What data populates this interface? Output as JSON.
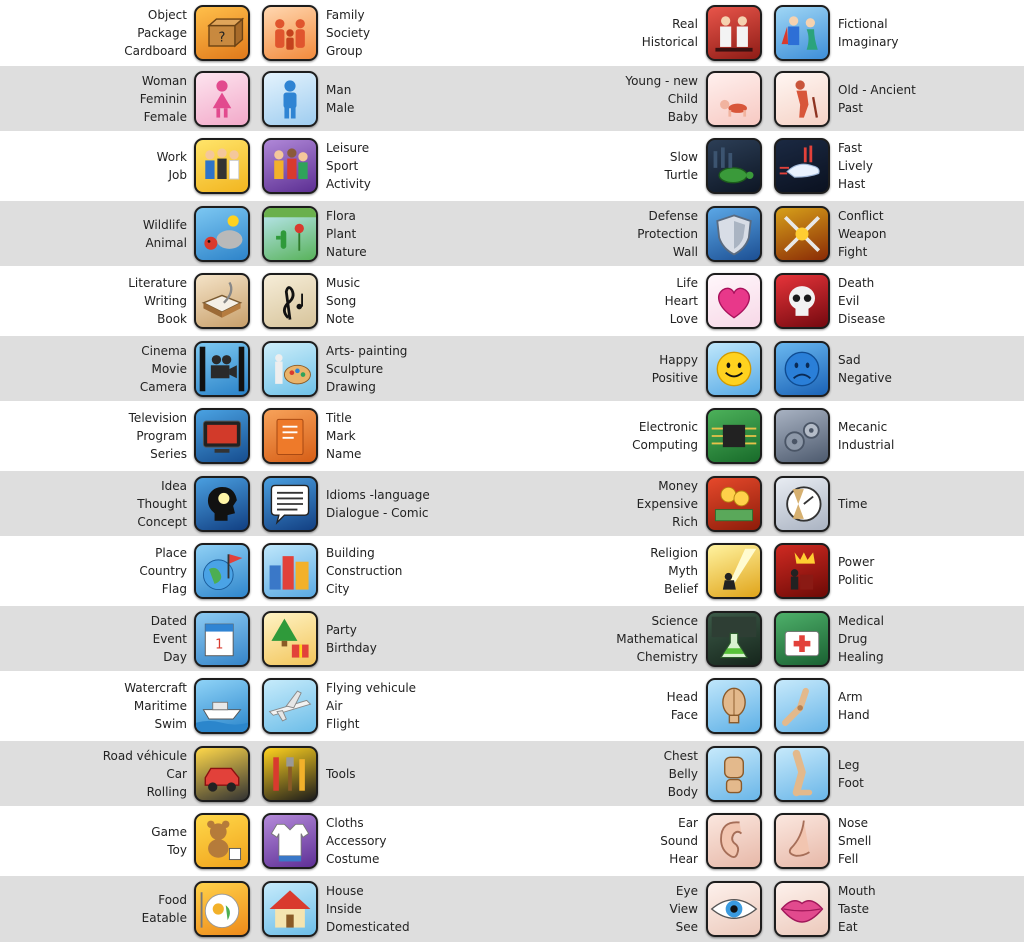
{
  "rows": [
    {
      "h": 66,
      "shaded": false,
      "cells": [
        {
          "words": [
            "Object",
            "Package",
            "Cardboard"
          ],
          "icon": "cardboard-box-icon",
          "bg": [
            "#ffbf4a",
            "#e0791b"
          ]
        },
        {
          "words": [
            "Family",
            "Society",
            "Group"
          ],
          "icon": "family-group-icon",
          "bg": [
            "#ffd7b0",
            "#f28a3c"
          ]
        },
        {
          "words": [
            "Real",
            "Historical"
          ],
          "icon": "historical-figures-icon",
          "bg": [
            "#e8554a",
            "#8e1c16"
          ]
        },
        {
          "words": [
            "Fictional",
            "Imaginary"
          ],
          "icon": "fictional-characters-icon",
          "bg": [
            "#9fd6f5",
            "#3d8ed8"
          ]
        }
      ]
    },
    {
      "h": 65,
      "shaded": true,
      "cells": [
        {
          "words": [
            "Woman",
            "Feminin",
            "Female"
          ],
          "icon": "woman-symbol-icon",
          "bg": [
            "#fde4ef",
            "#f2a9c9"
          ]
        },
        {
          "words": [
            "Man",
            "Male"
          ],
          "icon": "man-symbol-icon",
          "bg": [
            "#e4f3fd",
            "#9fcdf0"
          ]
        },
        {
          "words": [
            "Young - new",
            "Child",
            "Baby"
          ],
          "icon": "crawling-baby-icon",
          "bg": [
            "#fff0ee",
            "#f7c9c2"
          ]
        },
        {
          "words": [
            "Old - Ancient",
            "Past"
          ],
          "icon": "old-man-cane-icon",
          "bg": [
            "#fff6f2",
            "#f5d2c6"
          ]
        }
      ]
    },
    {
      "h": 70,
      "shaded": false,
      "cells": [
        {
          "words": [
            "Work",
            "Job"
          ],
          "icon": "workers-icon",
          "bg": [
            "#ffe46a",
            "#f2b51f"
          ]
        },
        {
          "words": [
            "Leisure",
            "Sport",
            "Activity"
          ],
          "icon": "leisure-people-icon",
          "bg": [
            "#b088d8",
            "#5c2f93"
          ]
        },
        {
          "words": [
            "Slow",
            "Turtle"
          ],
          "icon": "turtle-icon",
          "bg": [
            "#2c3e56",
            "#0d1624"
          ]
        },
        {
          "words": [
            "Fast",
            "Lively",
            "Hast"
          ],
          "icon": "fast-rabbit-icon",
          "bg": [
            "#1b2942",
            "#0a1120"
          ]
        }
      ]
    },
    {
      "h": 65,
      "shaded": true,
      "cells": [
        {
          "words": [
            "Wildlife",
            "Animal"
          ],
          "icon": "animals-icon",
          "bg": [
            "#7cc7f2",
            "#2d83c9"
          ]
        },
        {
          "words": [
            "Flora",
            "Plant",
            "Nature"
          ],
          "icon": "plants-icon",
          "bg": [
            "#bfe9f7",
            "#58b25a"
          ]
        },
        {
          "words": [
            "Defense",
            "Protection",
            "Wall"
          ],
          "icon": "shield-wall-icon",
          "bg": [
            "#5ba7e6",
            "#1c4f93"
          ]
        },
        {
          "words": [
            "Conflict",
            "Weapon",
            "Fight"
          ],
          "icon": "crossed-swords-icon",
          "bg": [
            "#d7a01a",
            "#8a2b06"
          ]
        }
      ]
    },
    {
      "h": 70,
      "shaded": false,
      "cells": [
        {
          "words": [
            "Literature",
            "Writing",
            "Book"
          ],
          "icon": "book-quill-icon",
          "bg": [
            "#f4e3c7",
            "#c89f6a"
          ]
        },
        {
          "words": [
            "Music",
            "Song",
            "Note"
          ],
          "icon": "treble-clef-icon",
          "bg": [
            "#f6edd8",
            "#d7c49b"
          ]
        },
        {
          "words": [
            "Life",
            "Heart",
            "Love"
          ],
          "icon": "heart-icon",
          "bg": [
            "#fff7fb",
            "#f7d8e7"
          ]
        },
        {
          "words": [
            "Death",
            "Evil",
            "Disease"
          ],
          "icon": "skull-icon",
          "bg": [
            "#e6343a",
            "#74090f"
          ]
        }
      ]
    },
    {
      "h": 65,
      "shaded": true,
      "cells": [
        {
          "words": [
            "Cinema",
            "Movie",
            "Camera"
          ],
          "icon": "movie-camera-icon",
          "bg": [
            "#7ec9f2",
            "#2a82c8"
          ]
        },
        {
          "words": [
            "Arts- painting",
            "Sculpture",
            "Drawing"
          ],
          "icon": "palette-statue-icon",
          "bg": [
            "#cdeefa",
            "#6ec1e8"
          ]
        },
        {
          "words": [
            "Happy",
            "Positive"
          ],
          "icon": "smiley-face-icon",
          "bg": [
            "#bfe7fb",
            "#56a9e5"
          ]
        },
        {
          "words": [
            "Sad",
            "Negative"
          ],
          "icon": "sad-face-icon",
          "bg": [
            "#6ab8f0",
            "#1a62b6"
          ]
        }
      ]
    },
    {
      "h": 70,
      "shaded": false,
      "cells": [
        {
          "words": [
            "Television",
            "Program",
            "Series"
          ],
          "icon": "television-icon",
          "bg": [
            "#4aa2e2",
            "#164d8f"
          ]
        },
        {
          "words": [
            "Title",
            "Mark",
            "Name"
          ],
          "icon": "title-card-icon",
          "bg": [
            "#f7a25a",
            "#d65e16"
          ]
        },
        {
          "words": [
            "Electronic",
            "Computing"
          ],
          "icon": "circuit-board-icon",
          "bg": [
            "#4cb15a",
            "#186b2a"
          ]
        },
        {
          "words": [
            "Mecanic",
            "Industrial"
          ],
          "icon": "gears-machine-icon",
          "bg": [
            "#a8b2c2",
            "#4d5a6e"
          ]
        }
      ]
    },
    {
      "h": 65,
      "shaded": true,
      "cells": [
        {
          "words": [
            "Idea",
            "Thought",
            "Concept"
          ],
          "icon": "head-lightbulb-icon",
          "bg": [
            "#4a9fe0",
            "#113f82"
          ]
        },
        {
          "words": [
            "Idioms -language",
            "Dialogue - Comic"
          ],
          "icon": "speech-bubble-icon",
          "bg": [
            "#4a9fe0",
            "#123f82"
          ]
        },
        {
          "words": [
            "Money",
            "Expensive",
            "Rich"
          ],
          "icon": "money-coins-icon",
          "bg": [
            "#e6492b",
            "#8d1c0a"
          ]
        },
        {
          "words": [
            "Time"
          ],
          "icon": "hourglass-clock-icon",
          "bg": [
            "#e8ecf2",
            "#aab3c2"
          ]
        }
      ]
    },
    {
      "h": 70,
      "shaded": false,
      "cells": [
        {
          "words": [
            "Place",
            "Country",
            "Flag"
          ],
          "icon": "globe-flag-icon",
          "bg": [
            "#8fd0f5",
            "#2f86cc"
          ]
        },
        {
          "words": [
            "Building",
            "Construction",
            "City"
          ],
          "icon": "city-buildings-icon",
          "bg": [
            "#bfe7fb",
            "#5aa9e2"
          ]
        },
        {
          "words": [
            "Religion",
            "Myth",
            "Belief"
          ],
          "icon": "praying-light-icon",
          "bg": [
            "#fff3a0",
            "#e0a41a"
          ]
        },
        {
          "words": [
            "Power",
            "Politic"
          ],
          "icon": "crown-speaker-icon",
          "bg": [
            "#cf2a22",
            "#6d0a06"
          ]
        }
      ]
    },
    {
      "h": 65,
      "shaded": true,
      "cells": [
        {
          "words": [
            "Dated",
            "Event",
            "Day"
          ],
          "icon": "calendar-icon",
          "bg": [
            "#8ccaf2",
            "#3584c8"
          ]
        },
        {
          "words": [
            "Party",
            "Birthday"
          ],
          "icon": "christmas-tree-gift-icon",
          "bg": [
            "#fff3c4",
            "#f2c55b"
          ]
        },
        {
          "words": [
            "Science",
            "Mathematical",
            "Chemistry"
          ],
          "icon": "flask-chalkboard-icon",
          "bg": [
            "#3c5a48",
            "#16261c"
          ]
        },
        {
          "words": [
            "Medical",
            "Drug",
            "Healing"
          ],
          "icon": "first-aid-kit-icon",
          "bg": [
            "#4eb06a",
            "#1a6132"
          ]
        }
      ]
    },
    {
      "h": 70,
      "shaded": false,
      "cells": [
        {
          "words": [
            "Watercraft",
            "Maritime",
            "Swim"
          ],
          "icon": "boat-icon",
          "bg": [
            "#8fd3f7",
            "#2b86cc"
          ]
        },
        {
          "words": [
            "Flying vehicule",
            "Air",
            "Flight"
          ],
          "icon": "airplane-icon",
          "bg": [
            "#c6ebfb",
            "#6cbde8"
          ]
        },
        {
          "words": [
            "Head",
            "Face"
          ],
          "icon": "mannequin-head-icon",
          "bg": [
            "#bfe6fb",
            "#5eb0e6"
          ]
        },
        {
          "words": [
            "Arm",
            "Hand"
          ],
          "icon": "mannequin-arm-icon",
          "bg": [
            "#c6e9fb",
            "#6ab6e8"
          ]
        }
      ]
    },
    {
      "h": 65,
      "shaded": true,
      "cells": [
        {
          "words": [
            "Road véhicule",
            "Car",
            "Rolling"
          ],
          "icon": "car-wheel-icon",
          "bg": [
            "#ffd84a",
            "#333333"
          ]
        },
        {
          "words": [
            "Tools"
          ],
          "icon": "tools-stripes-icon",
          "bg": [
            "#ffd21f",
            "#1c1c1c"
          ]
        },
        {
          "words": [
            "Chest",
            "Belly",
            "Body"
          ],
          "icon": "mannequin-body-icon",
          "bg": [
            "#c6e9fb",
            "#6ab6e8"
          ]
        },
        {
          "words": [
            "Leg",
            "Foot"
          ],
          "icon": "mannequin-leg-icon",
          "bg": [
            "#c6e9fb",
            "#6ab6e8"
          ]
        }
      ]
    },
    {
      "h": 70,
      "shaded": false,
      "cells": [
        {
          "words": [
            "Game",
            "Toy"
          ],
          "icon": "teddy-bear-dice-icon",
          "bg": [
            "#ffd84a",
            "#f0a31c"
          ]
        },
        {
          "words": [
            "Cloths",
            "Accessory",
            "Costume"
          ],
          "icon": "clothes-icon",
          "bg": [
            "#b48ad9",
            "#5e2f96"
          ]
        },
        {
          "words": [
            "Ear",
            "Sound",
            "Hear"
          ],
          "icon": "ear-icon",
          "bg": [
            "#fbe7df",
            "#e7b8a8"
          ]
        },
        {
          "words": [
            "Nose",
            "Smell",
            "Fell"
          ],
          "icon": "nose-icon",
          "bg": [
            "#fbe7df",
            "#e7b8a8"
          ]
        }
      ]
    },
    {
      "h": 66,
      "shaded": true,
      "cells": [
        {
          "words": [
            "Food",
            "Eatable"
          ],
          "icon": "food-plate-icon",
          "bg": [
            "#ffd24a",
            "#ee8a1a"
          ]
        },
        {
          "words": [
            "House",
            "Inside",
            "Domesticated"
          ],
          "icon": "house-icon",
          "bg": [
            "#c6ebfb",
            "#6cbde8"
          ]
        },
        {
          "words": [
            "Eye",
            "View",
            "See"
          ],
          "icon": "eye-icon",
          "bg": [
            "#fdf1ec",
            "#ecc9bb"
          ]
        },
        {
          "words": [
            "Mouth",
            "Taste",
            "Eat"
          ],
          "icon": "lips-mouth-icon",
          "bg": [
            "#fdf1ec",
            "#ecc9bb"
          ]
        }
      ]
    }
  ]
}
